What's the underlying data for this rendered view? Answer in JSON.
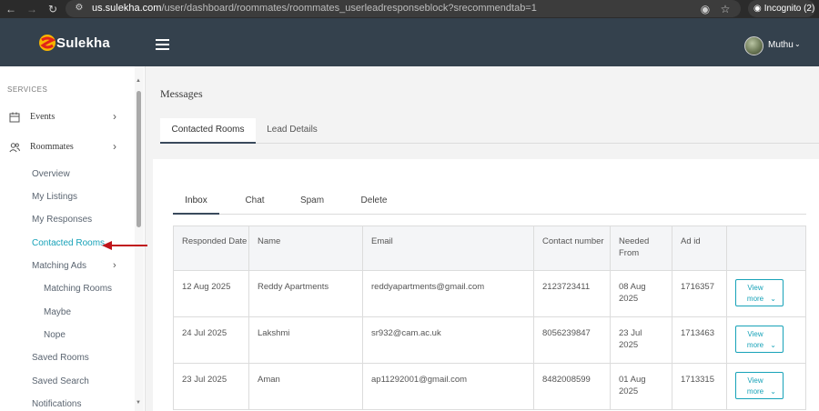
{
  "browser": {
    "url_host": "us.sulekha.com",
    "url_path": "/user/dashboard/roommates/roommates_userleadresponseblock?srecommendtab=1",
    "incognito_label": "Incognito (2)"
  },
  "header": {
    "logo_text": "Sulekha",
    "user_name": "Muthu"
  },
  "sidebar": {
    "section_label": "SERVICES",
    "main_items": [
      {
        "label": "Events",
        "icon": "calendar-icon"
      },
      {
        "label": "Roommates",
        "icon": "users-icon"
      }
    ],
    "sub_items": [
      {
        "label": "Overview"
      },
      {
        "label": "My Listings"
      },
      {
        "label": "My Responses"
      },
      {
        "label": "Contacted Rooms",
        "active": true
      },
      {
        "label": "Matching Ads"
      },
      {
        "label": "Matching Rooms"
      },
      {
        "label": "Maybe"
      },
      {
        "label": "Nope"
      },
      {
        "label": "Saved Rooms"
      },
      {
        "label": "Saved Search"
      },
      {
        "label": "Notifications"
      }
    ]
  },
  "main": {
    "title": "Messages",
    "tabs": [
      {
        "label": "Contacted Rooms",
        "active": true
      },
      {
        "label": "Lead Details",
        "active": false
      }
    ],
    "inner_tabs": [
      {
        "label": "Inbox",
        "active": true
      },
      {
        "label": "Chat"
      },
      {
        "label": "Spam"
      },
      {
        "label": "Delete"
      }
    ],
    "table": {
      "headers": [
        "Responded Date",
        "Name",
        "Email",
        "Contact number",
        "Needed From",
        "Ad id",
        ""
      ],
      "rows": [
        {
          "date": "12 Aug 2025",
          "name": "Reddy Apartments",
          "email": "reddyapartments@gmail.com",
          "contact": "2123723411",
          "needed": "08 Aug 2025",
          "ad_id": "1716357",
          "action": "View more"
        },
        {
          "date": "24 Jul 2025",
          "name": "Lakshmi",
          "email": "sr932@cam.ac.uk",
          "contact": "8056239847",
          "needed": "23 Jul 2025",
          "ad_id": "1713463",
          "action": "View more"
        },
        {
          "date": "23 Jul 2025",
          "name": "Aman",
          "email": "ap11292001@gmail.com",
          "contact": "8482008599",
          "needed": "01 Aug 2025",
          "ad_id": "1713315",
          "action": "View more"
        }
      ]
    }
  },
  "colors": {
    "header_bg": "#34414d",
    "accent": "#17a2b8",
    "annotation_arrow": "#c0151b"
  }
}
